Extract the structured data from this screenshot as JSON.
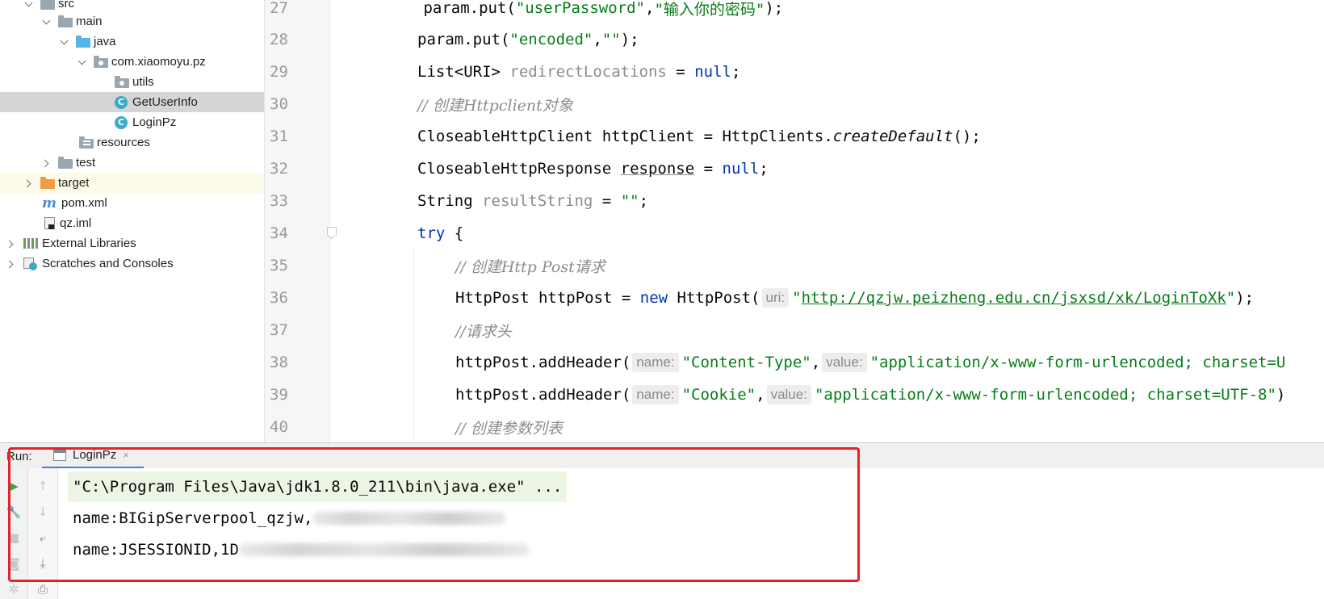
{
  "project_tree": {
    "items": [
      {
        "label": "src"
      },
      {
        "label": "main"
      },
      {
        "label": "java"
      },
      {
        "label": "com.xiaomoyu.pz"
      },
      {
        "label": "utils"
      },
      {
        "label": "GetUserInfo"
      },
      {
        "label": "LoginPz"
      },
      {
        "label": "resources"
      },
      {
        "label": "test"
      },
      {
        "label": "target"
      },
      {
        "label": "pom.xml"
      },
      {
        "label": "qz.iml"
      },
      {
        "label": "External Libraries"
      },
      {
        "label": "Scratches and Consoles"
      }
    ]
  },
  "editor": {
    "lines": [
      {
        "num": "27",
        "parts": [
          " param.put(",
          "\"userPassword\"",
          ",",
          "\"输入你的密码\"",
          ");"
        ]
      },
      {
        "num": "28",
        "parts": [
          "param.put(",
          "\"encoded\"",
          ",",
          "\"\"",
          ");"
        ]
      },
      {
        "num": "29",
        "parts": [
          "List<URI> ",
          "redirectLocations",
          " = ",
          "null",
          ";"
        ]
      },
      {
        "num": "30",
        "parts": [
          "// 创建Httpclient对象"
        ]
      },
      {
        "num": "31",
        "parts": [
          "CloseableHttpClient httpClient = HttpClients.",
          "createDefault",
          "();"
        ]
      },
      {
        "num": "32",
        "parts": [
          "CloseableHttpResponse ",
          "response",
          " = ",
          "null",
          ";"
        ]
      },
      {
        "num": "33",
        "parts": [
          "String ",
          "resultString",
          " = ",
          "\"\"",
          ";"
        ]
      },
      {
        "num": "34",
        "parts": [
          "try",
          " {"
        ]
      },
      {
        "num": "35",
        "parts": [
          "// 创建Http Post请求"
        ]
      },
      {
        "num": "36",
        "parts": [
          "HttpPost httpPost = ",
          "new",
          " HttpPost(",
          "uri:",
          "\"",
          "http://qzjw.peizheng.edu.cn/jsxsd/xk/LoginToXk",
          "\"",
          ");"
        ]
      },
      {
        "num": "37",
        "parts": [
          "//请求头"
        ]
      },
      {
        "num": "38",
        "parts": [
          "httpPost.addHeader(",
          "name:",
          "\"Content-Type\"",
          ",",
          "value:",
          "\"application/x-www-form-urlencoded; charset=U"
        ]
      },
      {
        "num": "39",
        "parts": [
          "httpPost.addHeader(",
          "name:",
          "\"Cookie\"",
          ",",
          "value:",
          "\"application/x-www-form-urlencoded; charset=UTF-8\"",
          ")"
        ]
      },
      {
        "num": "40",
        "parts": [
          "// 创建参数列表"
        ]
      }
    ]
  },
  "run_panel": {
    "label": "Run:",
    "tab_label": "LoginPz",
    "tab_close": "×",
    "console": [
      "\"C:\\Program Files\\Java\\jdk1.8.0_211\\bin\\java.exe\" ...",
      "name:BIGipServerpool_qzjw,",
      "name:JSESSIONID,1D"
    ]
  },
  "icons": {
    "run": "play-icon",
    "wrench": "wrench-icon",
    "stop": "stop-icon",
    "camera": "camera-icon",
    "up": "arrow-up-icon",
    "down": "arrow-down-icon",
    "wrap": "soft-wrap-icon",
    "scroll_end": "scroll-to-end-icon",
    "print": "print-icon"
  },
  "colors": {
    "highlight_box": "#e8202a",
    "string": "#067d17",
    "keyword": "#0033b3",
    "comment": "#8c8c8c"
  }
}
